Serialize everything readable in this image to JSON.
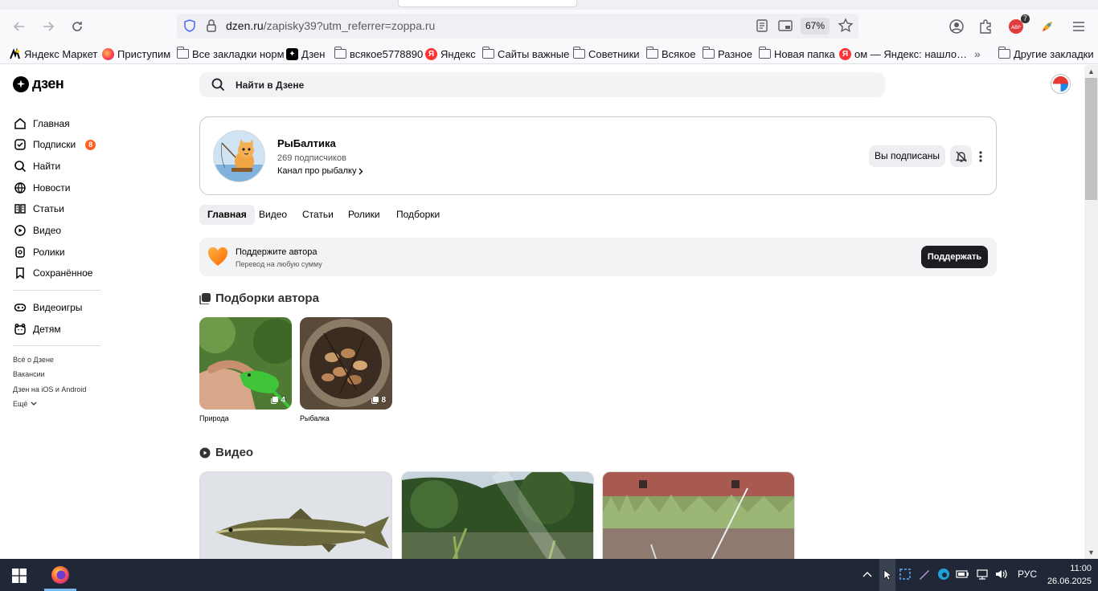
{
  "browser": {
    "url_domain": "dzen.ru",
    "url_path": "/zapisky39?utm_referrer=zoppa.ru",
    "zoom": "67%",
    "extension_badge": "7",
    "bookmarks": [
      {
        "label": "Яндекс Маркет",
        "icon": "yandex-market-icon"
      },
      {
        "label": "Приступим",
        "icon": "firefox-icon"
      },
      {
        "label": "Все закладки норм",
        "icon": "folder-icon"
      },
      {
        "label": "Дзен",
        "icon": "dzen-icon"
      },
      {
        "label": "всякое5778890",
        "icon": "folder-icon"
      },
      {
        "label": "Яндекс",
        "icon": "yandex-icon"
      },
      {
        "label": "Сайты важные",
        "icon": "folder-icon"
      },
      {
        "label": "Советники",
        "icon": "folder-icon"
      },
      {
        "label": "Всякое",
        "icon": "folder-icon"
      },
      {
        "label": "Разное",
        "icon": "folder-icon"
      },
      {
        "label": "Новая папка",
        "icon": "folder-icon"
      },
      {
        "label": "ом — Яндекс: нашло…",
        "icon": "yandex-icon"
      }
    ],
    "other_bookmarks": "Другие закладки"
  },
  "dzen": {
    "logo_text": "дзен",
    "search_placeholder": "Найти в Дзене",
    "nav": [
      {
        "label": "Главная",
        "icon": "home-icon"
      },
      {
        "label": "Подписки",
        "icon": "subscriptions-icon",
        "badge": "8"
      },
      {
        "label": "Найти",
        "icon": "search-icon"
      },
      {
        "label": "Новости",
        "icon": "news-icon"
      },
      {
        "label": "Статьи",
        "icon": "articles-icon"
      },
      {
        "label": "Видео",
        "icon": "video-icon"
      },
      {
        "label": "Ролики",
        "icon": "shorts-icon"
      },
      {
        "label": "Сохранённое",
        "icon": "bookmark-icon"
      }
    ],
    "nav2": [
      {
        "label": "Видеоигры",
        "icon": "gamepad-icon"
      },
      {
        "label": "Детям",
        "icon": "kids-icon"
      }
    ],
    "footer_links": [
      "Всё о Дзене",
      "Вакансии",
      "Дзен на iOS и Android",
      "Ещё"
    ],
    "channel": {
      "name": "РыБалтика",
      "subscribers": "269 подписчиков",
      "description": "Канал про рыбалку",
      "subscribed_label": "Вы подписаны"
    },
    "tabs": [
      "Главная",
      "Видео",
      "Статьи",
      "Ролики",
      "Подборки"
    ],
    "support": {
      "title": "Поддержите автора",
      "subtitle": "Перевод на любую сумму",
      "button": "Поддержать"
    },
    "collections_title": "Подборки автора",
    "collections": [
      {
        "caption": "Природа",
        "count": "4"
      },
      {
        "caption": "Рыбалка",
        "count": "8"
      }
    ],
    "video_title": "Видео"
  },
  "taskbar": {
    "lang": "РУС",
    "time": "11:00",
    "date": "26.06.2025"
  },
  "colors": {
    "badge_orange": "#ff5f1f",
    "taskbar": "#202736",
    "support_button": "#1c1d20"
  }
}
